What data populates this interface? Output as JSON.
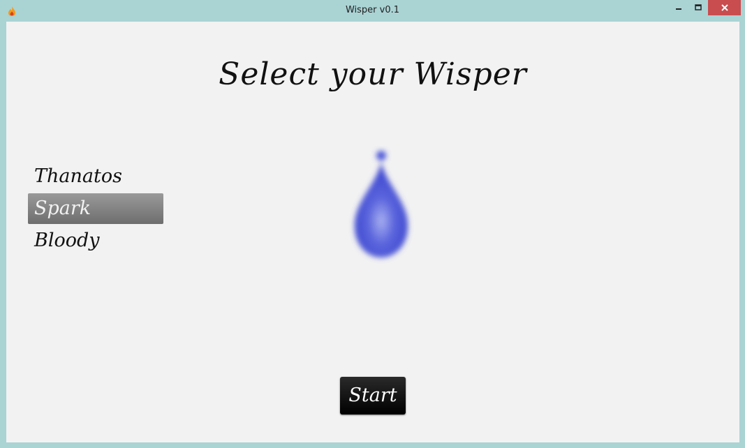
{
  "window": {
    "title": "Wisper v0.1",
    "app_icon": "flame-icon",
    "controls": [
      "minimize-icon",
      "maximize-icon",
      "close-icon"
    ],
    "close_color": "#c94c4f",
    "frame_color": "#aad3d4"
  },
  "main": {
    "heading": "Select your Wisper",
    "wispers": [
      {
        "label": "Thanatos",
        "selected": false
      },
      {
        "label": "Spark",
        "selected": true
      },
      {
        "label": "Bloody",
        "selected": false
      }
    ],
    "preview": {
      "icon": "wisp-flame-icon",
      "color": "#4a55d8"
    },
    "start_label": "Start"
  }
}
